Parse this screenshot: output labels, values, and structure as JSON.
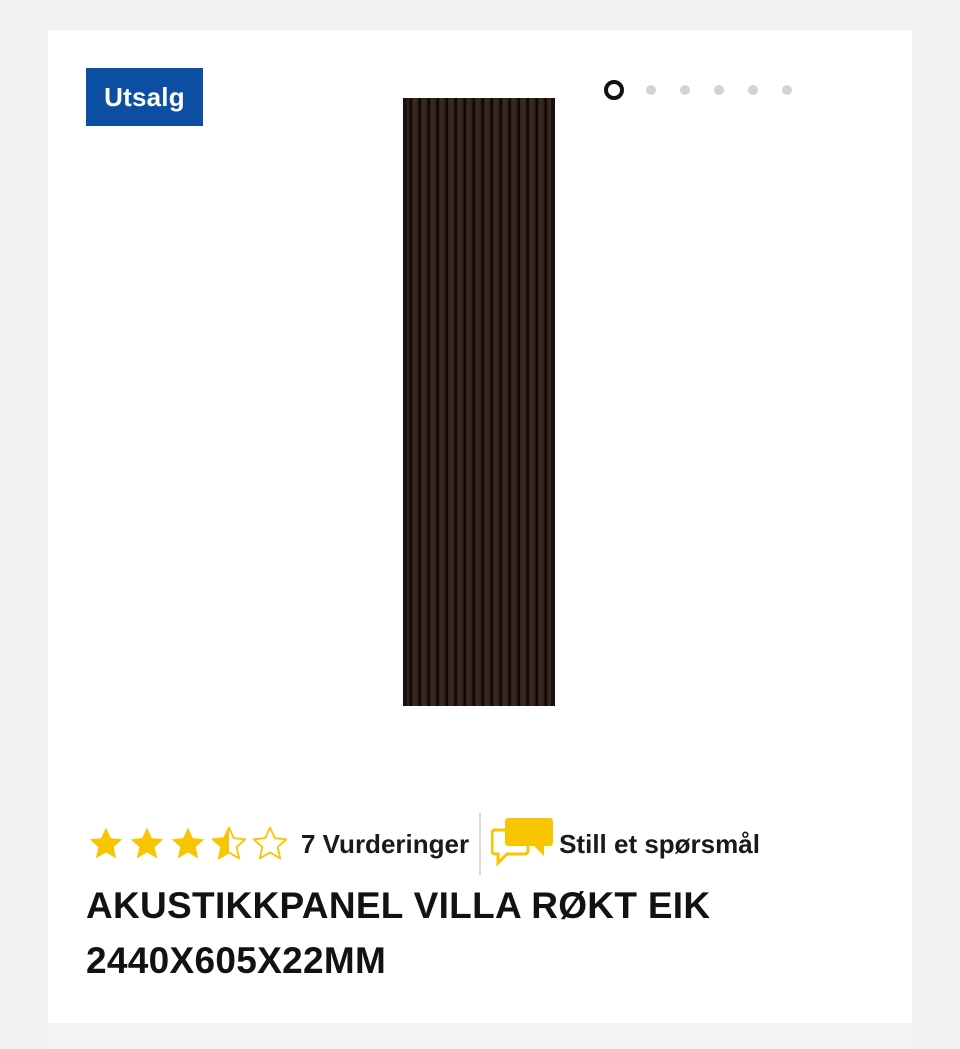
{
  "badge": {
    "label": "Utsalg",
    "color": "#0b4ea2"
  },
  "gallery": {
    "image_count": 6,
    "active_index": 0
  },
  "rating": {
    "value": 3.5,
    "max": 5,
    "star_color": "#f7c600"
  },
  "reviews": {
    "label": "7 Vurderinger"
  },
  "ask": {
    "label": "Still et spørsmål",
    "icon": "chat-bubbles-icon",
    "icon_color": "#f7c600"
  },
  "product": {
    "title_line1": "AKUSTIKKPANEL VILLA RØKT EIK",
    "title_line2": "2440X605X22MM"
  }
}
